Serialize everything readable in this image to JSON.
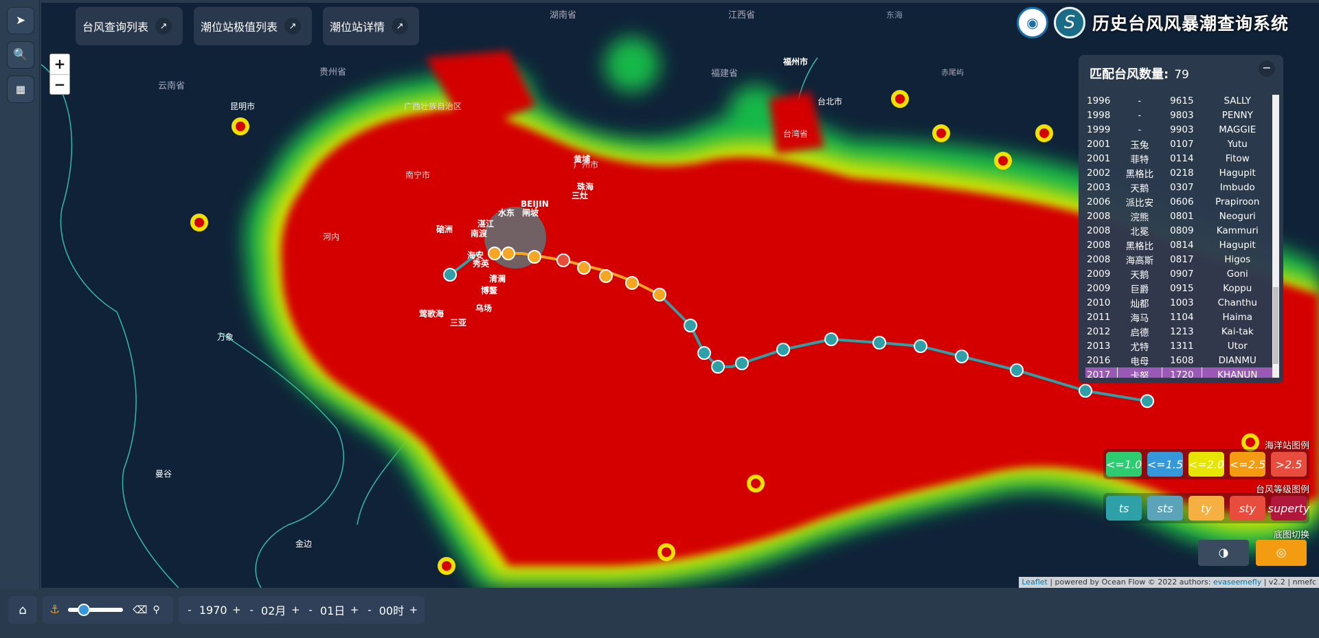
{
  "panels": {
    "typhoon_list_btn": "台风查询列表",
    "station_extreme_btn": "潮位站极值列表",
    "station_detail_btn": "潮位站详情"
  },
  "title": "历史台风风暴潮查询系统",
  "match": {
    "label": "匹配台风数量:",
    "count": "79",
    "rows": [
      {
        "year": "1996",
        "cn": "-",
        "code": "9615",
        "en": "SALLY"
      },
      {
        "year": "1998",
        "cn": "-",
        "code": "9803",
        "en": "PENNY"
      },
      {
        "year": "1999",
        "cn": "-",
        "code": "9903",
        "en": "MAGGIE"
      },
      {
        "year": "2001",
        "cn": "玉兔",
        "code": "0107",
        "en": "Yutu"
      },
      {
        "year": "2001",
        "cn": "菲特",
        "code": "0114",
        "en": "Fitow"
      },
      {
        "year": "2002",
        "cn": "黑格比",
        "code": "0218",
        "en": "Hagupit"
      },
      {
        "year": "2003",
        "cn": "天鹅",
        "code": "0307",
        "en": "Imbudo"
      },
      {
        "year": "2006",
        "cn": "派比安",
        "code": "0606",
        "en": "Prapiroon"
      },
      {
        "year": "2008",
        "cn": "浣熊",
        "code": "0801",
        "en": "Neoguri"
      },
      {
        "year": "2008",
        "cn": "北冕",
        "code": "0809",
        "en": "Kammuri"
      },
      {
        "year": "2008",
        "cn": "黑格比",
        "code": "0814",
        "en": "Hagupit"
      },
      {
        "year": "2008",
        "cn": "海高斯",
        "code": "0817",
        "en": "Higos"
      },
      {
        "year": "2009",
        "cn": "天鹅",
        "code": "0907",
        "en": "Goni"
      },
      {
        "year": "2009",
        "cn": "巨爵",
        "code": "0915",
        "en": "Koppu"
      },
      {
        "year": "2010",
        "cn": "灿都",
        "code": "1003",
        "en": "Chanthu"
      },
      {
        "year": "2011",
        "cn": "海马",
        "code": "1104",
        "en": "Haima"
      },
      {
        "year": "2012",
        "cn": "启德",
        "code": "1213",
        "en": "Kai-tak"
      },
      {
        "year": "2013",
        "cn": "尤特",
        "code": "1311",
        "en": "Utor"
      },
      {
        "year": "2016",
        "cn": "电母",
        "code": "1608",
        "en": "DIANMU"
      },
      {
        "year": "2017",
        "cn": "卡努",
        "code": "1720",
        "en": "KHANUN"
      }
    ]
  },
  "legend": {
    "ocean_title": "海洋站图例",
    "ocean": [
      {
        "label": "<=1.0",
        "color": "#2ecc71"
      },
      {
        "label": "<=1.5",
        "color": "#3498db"
      },
      {
        "label": "<=2.0",
        "color": "#e6e600"
      },
      {
        "label": "<=2.5",
        "color": "#f39c12"
      },
      {
        "label": ">2.5",
        "color": "#e74c3c"
      }
    ],
    "typhoon_title": "台风等级图例",
    "typhoon": [
      {
        "label": "ts",
        "color": "#2ea1a8"
      },
      {
        "label": "sts",
        "color": "#5ba3b8"
      },
      {
        "label": "ty",
        "color": "#f5b041"
      },
      {
        "label": "sty",
        "color": "#e74c3c"
      },
      {
        "label": "superty",
        "color": "#b0173a"
      }
    ],
    "base_title": "底图切换"
  },
  "attribution": {
    "leaflet": "Leaflet",
    "powered": "| powered by Ocean Flow © 2022 authors:",
    "author": "evaseemefly",
    "version": "| v2.2 | nmefc"
  },
  "bottom": {
    "year": "1970",
    "month": "02月",
    "day": "01日",
    "hour": "00时",
    "plus": "+",
    "minus": "-"
  },
  "map_labels": [
    "湖南省",
    "江西省",
    "东海",
    "贵州省",
    "福建省",
    "福州市",
    "赤尾屿",
    "云南省",
    "昆明市",
    "广西壮族自治区",
    "台北市",
    "台湾省",
    "南宁市",
    "广州市",
    "黄埔",
    "水东",
    "BEIJIN",
    "闸坡",
    "湛江",
    "南渡",
    "硇洲",
    "三灶",
    "珠海",
    "海安",
    "秀英",
    "清澜",
    "博鳌",
    "乌场",
    "三亚",
    "莺歌海",
    "万象",
    "曼谷",
    "金边",
    "河内"
  ],
  "colors": {
    "panel_bg": "#2c3a4e",
    "map_bg": "#0f2238",
    "heat_red": "#d40000",
    "track_ts": "#2ea1a8",
    "track_ty": "#f5a623",
    "track_sty": "#e74c3c",
    "selected_row": "#9b59b6",
    "accent_orange": "#f39c12"
  },
  "icons": [
    "locate-icon",
    "zoom-search-icon",
    "chart-icon",
    "expand-icon",
    "home-icon",
    "anchor-icon",
    "eraser-icon",
    "search-icon",
    "globe-icon",
    "earth-icon"
  ]
}
